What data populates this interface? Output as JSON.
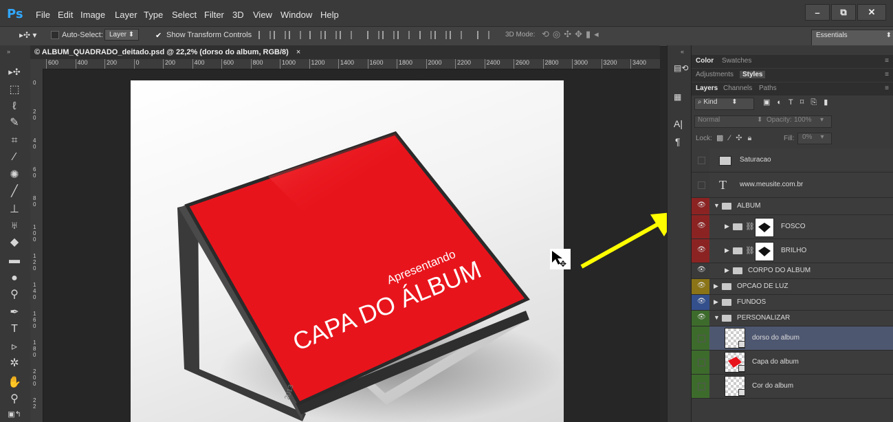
{
  "app": {
    "logo": "Ps"
  },
  "menu": [
    "File",
    "Edit",
    "Image",
    "Layer",
    "Type",
    "Select",
    "Filter",
    "3D",
    "View",
    "Window",
    "Help"
  ],
  "window_buttons": [
    "–",
    "⧉",
    "✕"
  ],
  "options": {
    "auto_select_label": "Auto-Select:",
    "auto_select_value": "Layer",
    "show_transform_label": "Show Transform Controls",
    "mode3d_label": "3D Mode:",
    "workspace": "Essentials"
  },
  "document": {
    "tab_title": "© ALBUM_QUADRADO_deitado.psd @ 22,2% (dorso do album, RGB/8)",
    "close": "×"
  },
  "ruler": {
    "h_ticks": [
      "600",
      "400",
      "200",
      "0",
      "200",
      "400",
      "600",
      "800",
      "1000",
      "1200",
      "1400",
      "1600",
      "1800",
      "2000",
      "2200",
      "2400",
      "2600",
      "2800",
      "3000",
      "3200",
      "3400"
    ],
    "v_ticks": [
      "0",
      "2 0",
      "4 0",
      "6 0",
      "8 0",
      "1 0 0",
      "1 2 0",
      "1 4 0",
      "1 6 0",
      "1 8 0",
      "2 0 0",
      "2 2"
    ]
  },
  "artwork": {
    "subtitle": "Apresentando",
    "title": "CAPA DO ÁLBUM",
    "cover_color": "#e8141c",
    "spine_text": "2013"
  },
  "panels": {
    "row1": [
      "Color",
      "Swatches"
    ],
    "row2": [
      "Adjustments",
      "Styles"
    ],
    "row3": [
      "Layers",
      "Channels",
      "Paths"
    ],
    "kind_label": "Kind",
    "blend_mode": "Normal",
    "opacity_label": "Opacity:",
    "opacity_value": "100%",
    "lock_label": "Lock:",
    "fill_label": "Fill:",
    "fill_value": "0%"
  },
  "layers": [
    {
      "name": "Saturacao",
      "type": "adjustment",
      "color": "#3c3c3c",
      "visible": false
    },
    {
      "name": "www.meusite.com.br",
      "type": "text",
      "color": "#3c3c3c",
      "visible": false
    },
    {
      "name": "ALBUM",
      "type": "group-open",
      "color": "#8b2323",
      "visible": true
    },
    {
      "name": "FOSCO",
      "type": "group-masked",
      "color": "#8b2323",
      "visible": true
    },
    {
      "name": "BRILHO",
      "type": "group-masked",
      "color": "#8b2323",
      "visible": true
    },
    {
      "name": "CORPO DO ALBUM",
      "type": "group",
      "color": "#3c3c3c",
      "visible": true
    },
    {
      "name": "OPCAO DE LUZ",
      "type": "group",
      "color": "#8a7417",
      "visible": true
    },
    {
      "name": "FUNDOS",
      "type": "group",
      "color": "#33508c",
      "visible": true
    },
    {
      "name": "PERSONALIZAR",
      "type": "group-open",
      "color": "#3d6b2c",
      "visible": true
    },
    {
      "name": "dorso do album",
      "type": "smart",
      "color": "#3d6b2c",
      "visible": false,
      "selected": true
    },
    {
      "name": "Capa do album",
      "type": "smart-red",
      "color": "#3d6b2c",
      "visible": false
    },
    {
      "name": "Cor do album",
      "type": "smart",
      "color": "#3d6b2c",
      "visible": false
    }
  ],
  "icons": [
    "move-tool-icon",
    "marquee-icon",
    "lasso-icon",
    "quick-select-icon",
    "crop-icon",
    "eyedropper-icon",
    "heal-icon",
    "brush-icon",
    "stamp-icon",
    "history-brush-icon",
    "eraser-icon",
    "gradient-icon",
    "blur-icon",
    "dodge-icon",
    "pen-icon",
    "type-icon",
    "path-select-icon",
    "shape-icon",
    "hand-icon",
    "zoom-icon"
  ]
}
